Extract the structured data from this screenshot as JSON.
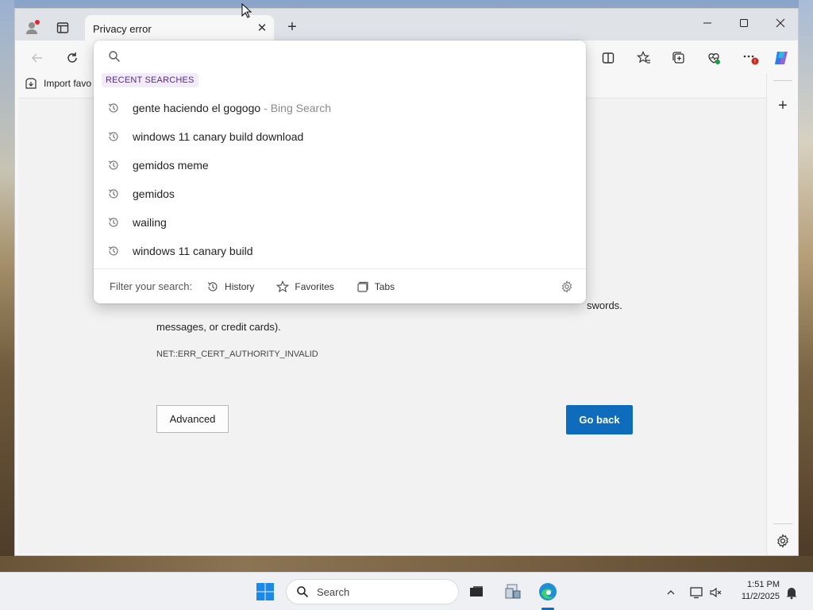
{
  "window": {
    "tab_title": "Privacy error"
  },
  "toolbar": {
    "favorites_item": "Import favo"
  },
  "page": {
    "text_fragment_right": "swords.",
    "text_line2": "messages, or credit cards).",
    "error_code": "NET::ERR_CERT_AUTHORITY_INVALID",
    "advanced_label": "Advanced",
    "go_back_label": "Go back"
  },
  "dropdown": {
    "placeholder": "",
    "section_label": "RECENT SEARCHES",
    "items": [
      {
        "text": "gente haciendo el gogogo",
        "suffix": "- Bing Search"
      },
      {
        "text": "windows 11 canary build download",
        "suffix": ""
      },
      {
        "text": "gemidos meme",
        "suffix": ""
      },
      {
        "text": "gemidos",
        "suffix": ""
      },
      {
        "text": "wailing",
        "suffix": ""
      },
      {
        "text": "windows 11 canary build",
        "suffix": ""
      }
    ],
    "filter_label": "Filter your search:",
    "filters": [
      "History",
      "Favorites",
      "Tabs"
    ]
  },
  "taskbar": {
    "search_label": "Search",
    "time": "1:51 PM",
    "date": "11/2/2025"
  },
  "colors": {
    "accent": "#0f6cbd",
    "section_bg": "#f1ecf7",
    "section_text": "#5a2a8a"
  },
  "icons": [
    "profile-icon",
    "workspaces-icon",
    "close-icon",
    "new-tab-icon",
    "minimize-icon",
    "maximize-icon",
    "back-icon",
    "refresh-icon",
    "split-screen-icon",
    "favorites-icon",
    "collections-icon",
    "browser-essentials-icon",
    "more-icon",
    "copilot-icon",
    "search-icon",
    "history-icon",
    "star-icon",
    "tabs-icon",
    "gear-icon",
    "windows-start-icon",
    "file-explorer-icon",
    "edge-icon",
    "chevron-up-icon",
    "network-icon",
    "volume-muted-icon",
    "notification-icon"
  ]
}
